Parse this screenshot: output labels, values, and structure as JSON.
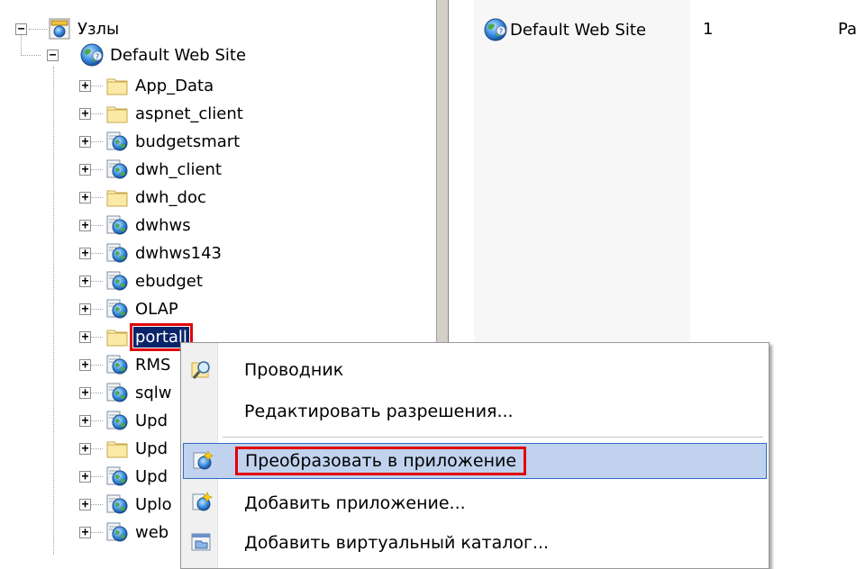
{
  "tree": {
    "root": {
      "label": "Узлы",
      "icon": "server-icon"
    },
    "site": {
      "label": "Default Web Site",
      "icon": "globe-icon"
    },
    "children": [
      {
        "label": "App_Data",
        "icon": "folder-icon"
      },
      {
        "label": "aspnet_client",
        "icon": "folder-icon"
      },
      {
        "label": "budgetsmart",
        "icon": "web-app-icon"
      },
      {
        "label": "dwh_client",
        "icon": "web-app-icon"
      },
      {
        "label": "dwh_doc",
        "icon": "folder-icon"
      },
      {
        "label": "dwhws",
        "icon": "web-app-icon"
      },
      {
        "label": "dwhws143",
        "icon": "web-app-icon"
      },
      {
        "label": "ebudget",
        "icon": "web-app-icon"
      },
      {
        "label": "OLAP",
        "icon": "web-app-icon"
      },
      {
        "label": "portall",
        "icon": "folder-icon",
        "selected": true
      },
      {
        "label": "RMS",
        "icon": "web-app-icon"
      },
      {
        "label": "sqlw",
        "icon": "web-app-icon"
      },
      {
        "label": "Upd",
        "icon": "web-app-icon"
      },
      {
        "label": "Upd",
        "icon": "folder-icon"
      },
      {
        "label": "Upd",
        "icon": "web-app-icon"
      },
      {
        "label": "Uplo",
        "icon": "web-app-icon"
      },
      {
        "label": "web",
        "icon": "web-app-icon"
      }
    ]
  },
  "list": {
    "row": {
      "name": "Default Web Site",
      "id": "1",
      "status": "Pa",
      "icon": "globe-icon"
    }
  },
  "context_menu": {
    "items": [
      {
        "label": "Проводник",
        "icon": "explorer-icon"
      },
      {
        "label": "Редактировать разрешения...",
        "icon": ""
      },
      {
        "label": "Преобразовать в приложение",
        "icon": "convert-app-icon",
        "highlighted": true
      },
      {
        "label": "Добавить приложение...",
        "icon": "add-app-icon"
      },
      {
        "label": "Добавить виртуальный каталог...",
        "icon": "add-vdir-icon"
      }
    ]
  },
  "colors": {
    "selection": "#0a246a",
    "annotation": "#e00000",
    "menu_highlight": "#c1d2ee",
    "menu_highlight_border": "#316ac5"
  }
}
